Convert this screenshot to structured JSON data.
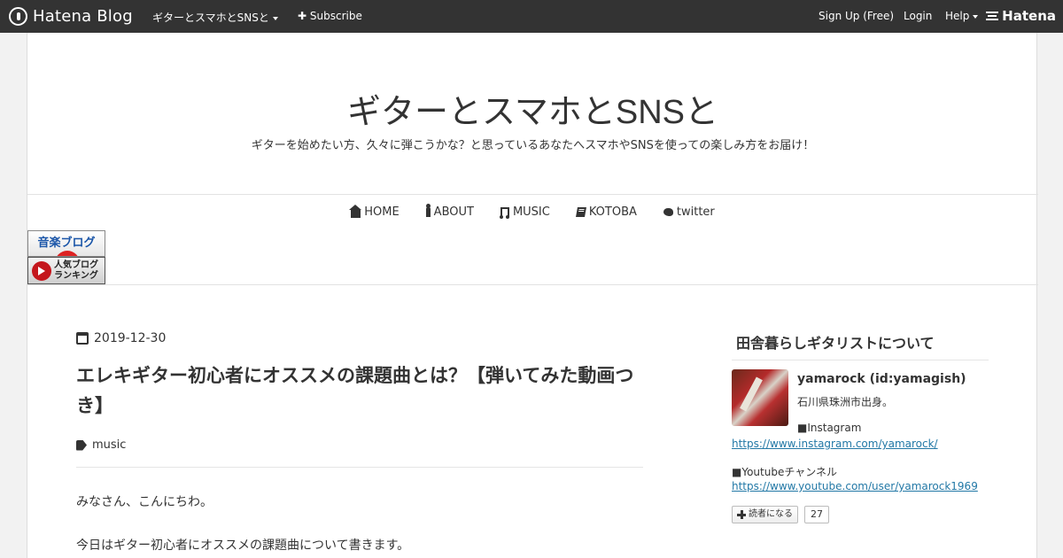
{
  "topbar": {
    "brand": "Hatena Blog",
    "blog_menu": "ギターとスマホとSNSと",
    "subscribe": "Subscribe",
    "signup": "Sign Up (Free)",
    "login": "Login",
    "help": "Help",
    "hatena": "Hatena"
  },
  "header": {
    "title": "ギターとスマホとSNSと",
    "description": "ギターを始めたい方、久々に弾こうかな？と思っているあなたへスマホやSNSを使っての楽しみ方をお届け！"
  },
  "nav": {
    "items": [
      {
        "label": "HOME",
        "icon": "home-icon"
      },
      {
        "label": "ABOUT",
        "icon": "user-icon"
      },
      {
        "label": "MUSIC",
        "icon": "music-icon"
      },
      {
        "label": "KOTOBA",
        "icon": "book-icon"
      },
      {
        "label": "twitter",
        "icon": "twitter-icon"
      }
    ]
  },
  "banners": {
    "music_blog": "音楽ブログ",
    "ranking_line1": "人気ブログ",
    "ranking_line2": "ランキング"
  },
  "article": {
    "date": "2019-12-30",
    "title": "エレキギター初心者にオススメの課題曲とは？【弾いてみた動画つき】",
    "category": "music",
    "paragraphs": [
      "みなさん、こんにちわ。",
      "今日はギター初心者にオススメの課題曲について書きます。"
    ]
  },
  "sidebar": {
    "heading": "田舎暮らしギタリストについて",
    "name": "yamarock (id:yamagish)",
    "location": "石川県珠洲市出身。",
    "instagram_label": "■Instagram",
    "instagram_url": "https://www.instagram.com/yamarock/",
    "youtube_label": "■Youtubeチャンネル",
    "youtube_url": "https://www.youtube.com/user/yamarock1969",
    "subscribe_label": "読者になる",
    "subscriber_count": "27"
  },
  "colors": {
    "topbar_bg": "#333333",
    "link": "#2278a6",
    "page_bg": "#f2f2f2"
  }
}
